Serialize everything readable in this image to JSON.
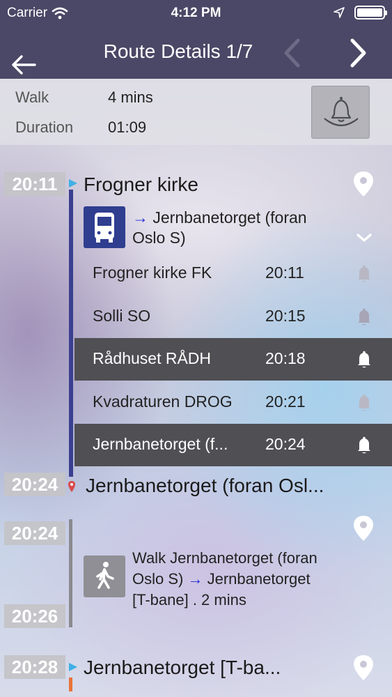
{
  "status_bar": {
    "carrier": "Carrier",
    "time": "4:12 PM"
  },
  "nav": {
    "title": "Route Details 1/7"
  },
  "summary": {
    "walk_label": "Walk",
    "walk_value": "4 mins",
    "duration_label": "Duration",
    "duration_value": "01:09"
  },
  "origin": {
    "time": "20:11",
    "name": "Frogner kirke"
  },
  "bus_leg": {
    "arrow": "→",
    "destination_line1": "Jernbanetorget (foran",
    "destination_line2": "Oslo S)",
    "stops": [
      {
        "name": "Frogner kirke FK",
        "time": "20:11",
        "highlighted": false
      },
      {
        "name": "Solli SO",
        "time": "20:15",
        "highlighted": false
      },
      {
        "name": "Rådhuset RÅDH",
        "time": "20:18",
        "highlighted": true
      },
      {
        "name": "Kvadraturen DROG",
        "time": "20:21",
        "highlighted": false
      },
      {
        "name": "Jernbanetorget (f...",
        "time": "20:24",
        "highlighted": true
      }
    ]
  },
  "bus_arrival": {
    "time": "20:24",
    "name": "Jernbanetorget (foran Osl..."
  },
  "walk_leg": {
    "start_time": "20:24",
    "end_time": "20:26",
    "line1": "Walk Jernbanetorget (foran",
    "line2_a": "Oslo S) ",
    "arrow": "→",
    "line2_b": " Jernbanetorget",
    "line3": "[T-bane] . 2 mins"
  },
  "next_stop": {
    "time": "20:28",
    "name": "Jernbanetorget [T-ba..."
  },
  "colors": {
    "nav_bg": "#4b4766",
    "bus_line": "#3a3f8f",
    "highlight_row": "#4f4f54",
    "arrow": "#1e28d8",
    "walk_connector": "#e8743a"
  },
  "icons": [
    "wifi-icon",
    "location-arrow-icon",
    "battery-icon",
    "back-arrow-icon",
    "chevron-left-icon",
    "chevron-right-icon",
    "bell-icon",
    "map-pin-icon",
    "bus-icon",
    "chevron-down-icon",
    "walk-icon"
  ]
}
